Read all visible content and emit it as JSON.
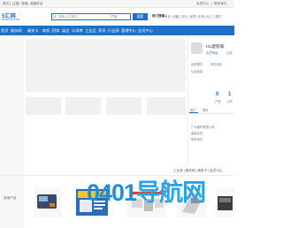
{
  "topbar": {
    "links": [
      "首页",
      "|",
      "注册",
      "|",
      "搜索",
      "|",
      "收藏本站"
    ],
    "right": [
      "会员中心",
      "|",
      "联系我们"
    ]
  },
  "logo": {
    "text": "5汇网",
    "sub": "WWW.5HUI.COM"
  },
  "search": {
    "placeholder": "请输入关键词",
    "select": "产品",
    "button": "搜索"
  },
  "hot": {
    "label": "热门搜索：",
    "links": "手机 | 电脑 | 衬衫 | 家具 | 机械 | 化工 | 建材"
  },
  "nav": [
    "首页",
    "服务网",
    "服务卡",
    "商机",
    "招商",
    "展会",
    "公司库",
    "工业品",
    "资讯",
    "行业网",
    "管理中心",
    "会员中心"
  ],
  "right_panel": {
    "title": "HL建管家",
    "sub1": "会员等级",
    "sub2": "认证",
    "info": [
      "经营模式",
      "所在地区",
      "认证信息"
    ],
    "stats": [
      {
        "num": "0",
        "label": "产品"
      },
      {
        "num": "1",
        "label": "公司"
      }
    ],
    "tabs": [
      "简介",
      "联系"
    ],
    "lines": [
      "广州建材有限公司",
      "高级会员",
      "联系我们"
    ]
  },
  "footer_links": "工业品 | 服务网 | 服务卡 | 会员中心",
  "other_label": "其他产品",
  "watermark": {
    "prefix": "0401",
    "suffix": "导航网"
  }
}
